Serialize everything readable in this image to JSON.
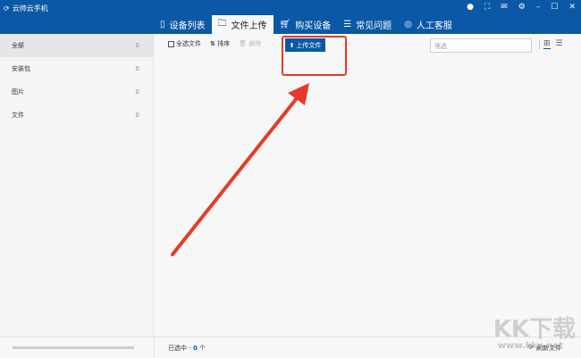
{
  "app": {
    "title": "云帅云手机"
  },
  "window_controls": [
    "user-icon",
    "fullscreen-icon",
    "mail-icon",
    "gear-icon",
    "minimize-icon",
    "maximize-icon",
    "close-icon"
  ],
  "tabs": [
    {
      "label": "设备列表",
      "icon": "phone-icon"
    },
    {
      "label": "文件上传",
      "icon": "folder-icon",
      "active": true
    },
    {
      "label": "购买设备",
      "icon": "cart-icon"
    },
    {
      "label": "常见问题",
      "icon": "list-icon"
    },
    {
      "label": "人工客服",
      "icon": "headset-icon"
    }
  ],
  "sidebar": {
    "items": [
      {
        "label": "全部",
        "count": "0"
      },
      {
        "label": "安装包",
        "count": "0"
      },
      {
        "label": "图片",
        "count": "0"
      },
      {
        "label": "文件",
        "count": "0"
      }
    ]
  },
  "toolbar": {
    "select_all": "全选文件",
    "sort": "排序",
    "delete": "删除",
    "upload": "上传文件",
    "search_placeholder": "筛选"
  },
  "footer": {
    "selected_prefix": "已选中 - ",
    "selected_count": "0",
    "selected_suffix": " 个",
    "refresh": "刷新文件"
  },
  "watermark": {
    "text": "KK下载",
    "url": "www.kkx.net"
  },
  "colors": {
    "brand": "#0b58a6",
    "annotation": "#e53a2a"
  }
}
